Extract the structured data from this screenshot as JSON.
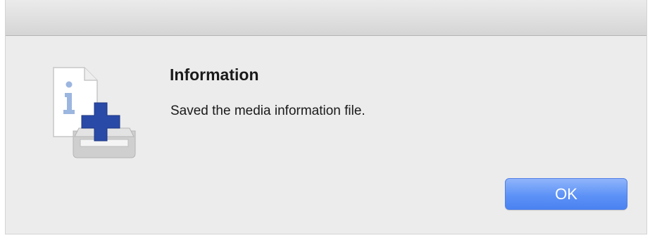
{
  "dialog": {
    "title": "Information",
    "message": "Saved the media information file.",
    "ok_label": "OK",
    "icon": "media-info-add-icon"
  },
  "colors": {
    "accent": "#5d92f6",
    "icon_cross": "#2a4aa8",
    "icon_info": "#9bb6df"
  }
}
